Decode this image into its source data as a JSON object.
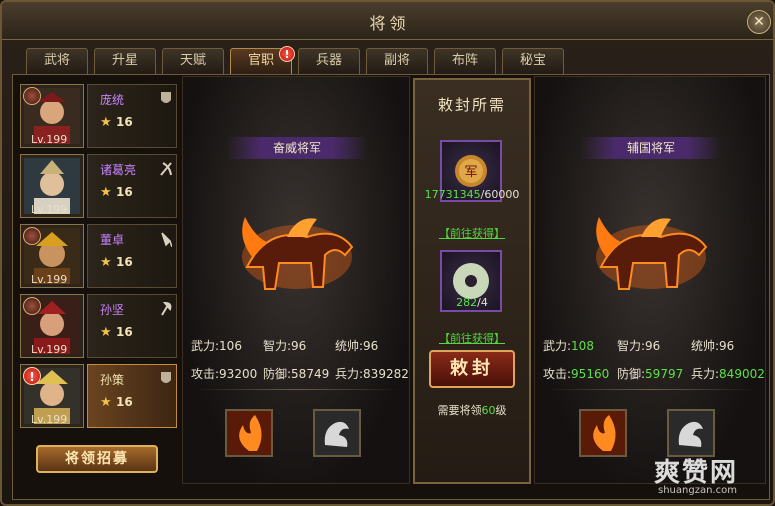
{
  "window": {
    "title": "将领",
    "close": "✕"
  },
  "tabs": [
    {
      "label": "武将"
    },
    {
      "label": "升星"
    },
    {
      "label": "天赋"
    },
    {
      "label": "官职"
    },
    {
      "label": "兵器"
    },
    {
      "label": "副将"
    },
    {
      "label": "布阵"
    },
    {
      "label": "秘宝"
    }
  ],
  "tab_badge": "!",
  "generals": [
    {
      "name": "庞统",
      "level": "Lv.199",
      "stars": "16",
      "name_color": "purple"
    },
    {
      "name": "诸葛亮",
      "level": "Lv.199",
      "stars": "16",
      "name_color": "purple"
    },
    {
      "name": "董卓",
      "level": "Lv.199",
      "stars": "16",
      "name_color": "purple"
    },
    {
      "name": "孙坚",
      "level": "Lv.199",
      "stars": "16",
      "name_color": "purple"
    },
    {
      "name": "孙策",
      "level": "Lv.199",
      "stars": "16",
      "name_color": "gold",
      "alert": "!"
    }
  ],
  "recruit_label": "将领招募",
  "current": {
    "rank": "奋威将军",
    "stats": {
      "wuli_label": "武力:",
      "wuli": "106",
      "zhili_label": "智力:",
      "zhili": "96",
      "tongshuai_label": "统帅:",
      "tongshuai": "96",
      "attack_label": "攻击:",
      "attack": "93200",
      "defense_label": "防御:",
      "defense": "58749",
      "troops_label": "兵力:",
      "troops": "839282"
    }
  },
  "next": {
    "rank": "辅国将军",
    "stats": {
      "wuli_label": "武力:",
      "wuli": "108",
      "zhili_label": "智力:",
      "zhili": "96",
      "tongshuai_label": "统帅:",
      "tongshuai": "96",
      "attack_label": "攻击:",
      "attack": "95160",
      "defense_label": "防御:",
      "defense": "59797",
      "troops_label": "兵力:",
      "troops": "849002"
    }
  },
  "requirements": {
    "title": "敕封所需",
    "item1_have": "17731345",
    "item1_need": "/60000",
    "item1_icon_text": "军",
    "item2_have": "282",
    "item2_need": "/4",
    "goto_label": "【前往获得】",
    "confer_label": "敕封",
    "need_level_prefix": "需要将领",
    "need_level_value": "60",
    "need_level_suffix": "级"
  },
  "watermark": {
    "main": "爽赞网",
    "url": "shuangzan.com"
  },
  "colors": {
    "green": "#5ee04a",
    "purple_name": "#c884ff",
    "gold_frame": "#e0b15b"
  }
}
